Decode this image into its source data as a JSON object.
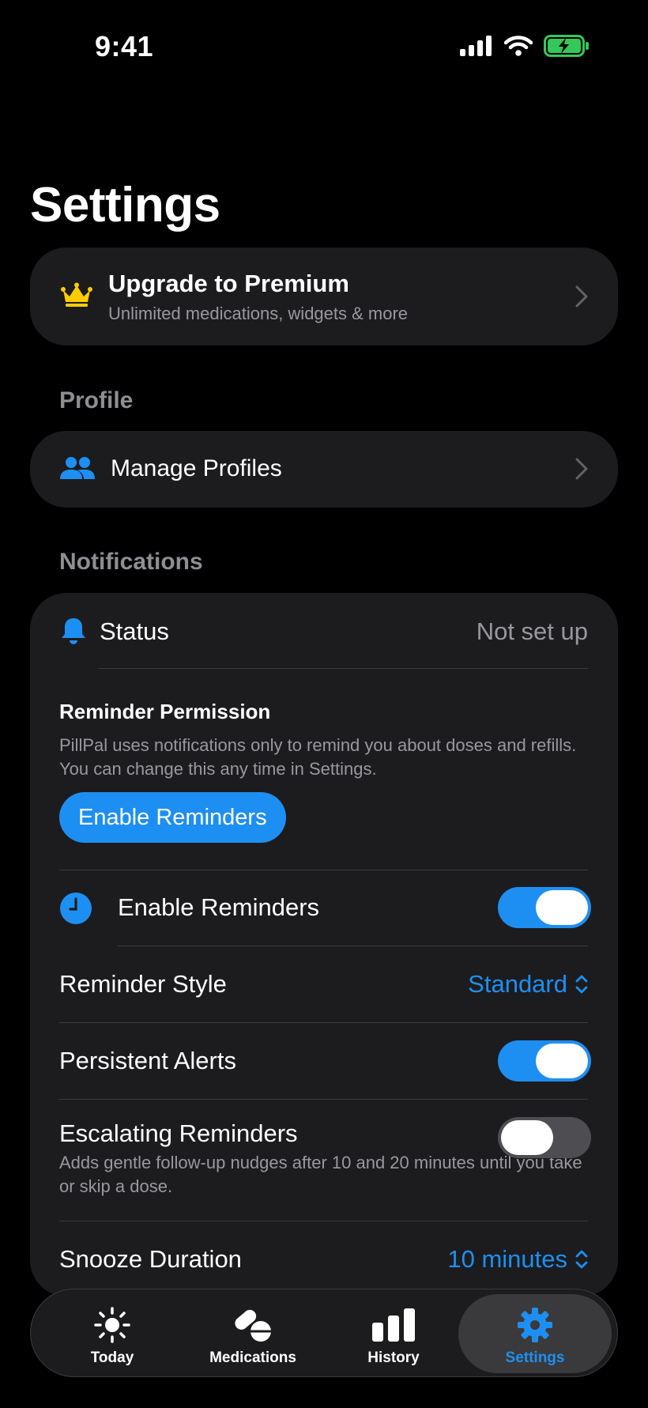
{
  "status_bar": {
    "time": "9:41"
  },
  "page_title": "Settings",
  "premium": {
    "title": "Upgrade to Premium",
    "subtitle": "Unlimited medications, widgets & more"
  },
  "profile_section": {
    "header": "Profile",
    "manage_label": "Manage Profiles"
  },
  "notifications": {
    "header": "Notifications",
    "status_label": "Status",
    "status_value": "Not set up",
    "permission_title": "Reminder Permission",
    "permission_desc": "PillPal uses notifications only to remind you about doses and refills. You can change this any time in Settings.",
    "permission_button": "Enable Reminders",
    "enable_reminders_label": "Enable Reminders",
    "enable_reminders_on": true,
    "reminder_style_label": "Reminder Style",
    "reminder_style_value": "Standard",
    "persistent_alerts_label": "Persistent Alerts",
    "persistent_alerts_on": true,
    "escalating_label": "Escalating Reminders",
    "escalating_desc": "Adds gentle follow-up nudges after 10 and 20 minutes until you take or skip a dose.",
    "escalating_on": false,
    "snooze_label": "Snooze Duration",
    "snooze_value": "10 minutes"
  },
  "tabs": [
    {
      "label": "Today",
      "icon": "sun-icon"
    },
    {
      "label": "Medications",
      "icon": "pills-icon"
    },
    {
      "label": "History",
      "icon": "bar-chart-icon"
    },
    {
      "label": "Settings",
      "icon": "gear-icon",
      "active": true
    }
  ],
  "colors": {
    "accent": "#1e8ff2",
    "card": "#1c1c1e",
    "crown": "#ffcc00"
  }
}
